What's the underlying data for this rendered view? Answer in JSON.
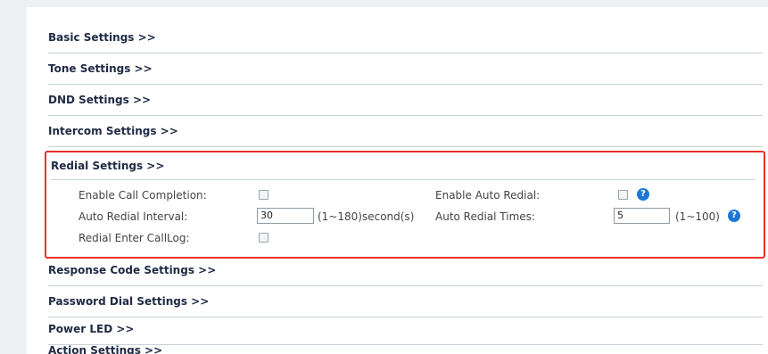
{
  "sections_top": [
    {
      "label": "Basic Settings >>"
    },
    {
      "label": "Tone Settings >>"
    },
    {
      "label": "DND Settings >>"
    },
    {
      "label": "Intercom Settings >>"
    }
  ],
  "redial": {
    "title": "Redial Settings >>",
    "enable_call_completion_label": "Enable Call Completion:",
    "enable_call_completion_checked": false,
    "auto_redial_interval_label": "Auto Redial Interval:",
    "auto_redial_interval_value": "30",
    "auto_redial_interval_hint": "(1~180)second(s)",
    "redial_enter_calllog_label": "Redial Enter CallLog:",
    "redial_enter_calllog_checked": false,
    "enable_auto_redial_label": "Enable Auto Redial:",
    "enable_auto_redial_checked": false,
    "auto_redial_times_label": "Auto Redial Times:",
    "auto_redial_times_value": "5",
    "auto_redial_times_hint": "(1~100)",
    "help_glyph": "?"
  },
  "sections_bottom": [
    {
      "label": "Response Code Settings >>"
    },
    {
      "label": "Password Dial Settings >>"
    },
    {
      "label": "Power LED >>"
    }
  ],
  "cut_off_label": "Action Settings >>",
  "colors": {
    "highlight_border": "#e8312b",
    "help_icon": "#1e78d2",
    "header_text": "#1f2a44"
  }
}
